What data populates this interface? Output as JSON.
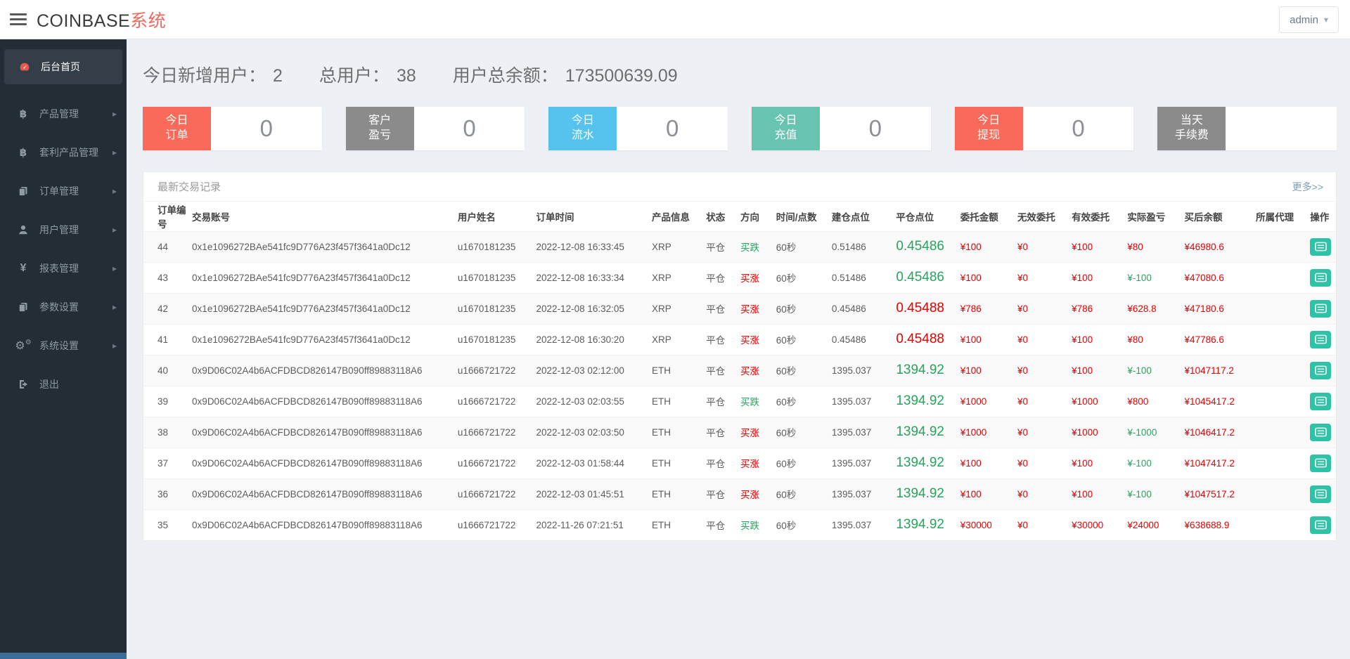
{
  "header": {
    "brand_main": "COINBASE",
    "brand_accent": "系统",
    "user_menu": "admin"
  },
  "colors": {
    "brand_accent_red": "#ed6a5e",
    "money_red": "#e60000",
    "gain_green": "#27a35d",
    "action_teal": "#2cc3a6",
    "sidebar_dark": "#232d36"
  },
  "sidebar": {
    "items": [
      {
        "label": "后台首页",
        "icon": "dashboard-icon",
        "active": true,
        "has_arrow": false
      },
      {
        "label": "产品管理",
        "icon": "bitcoin-icon",
        "active": false,
        "has_arrow": true
      },
      {
        "label": "套利产品管理",
        "icon": "bitcoin-icon",
        "active": false,
        "has_arrow": true
      },
      {
        "label": "订单管理",
        "icon": "copy-icon",
        "active": false,
        "has_arrow": true
      },
      {
        "label": "用户管理",
        "icon": "user-icon",
        "active": false,
        "has_arrow": true
      },
      {
        "label": "报表管理",
        "icon": "yen-icon",
        "active": false,
        "has_arrow": true
      },
      {
        "label": "参数设置",
        "icon": "copy-icon",
        "active": false,
        "has_arrow": true
      },
      {
        "label": "系统设置",
        "icon": "gears-icon",
        "active": false,
        "has_arrow": true
      },
      {
        "label": "退出",
        "icon": "signout-icon",
        "active": false,
        "has_arrow": false
      }
    ]
  },
  "stats": [
    {
      "label": "今日新增用户：",
      "value": "2"
    },
    {
      "label": "总用户：",
      "value": "38"
    },
    {
      "label": "用户总余额：",
      "value": "173500639.09"
    }
  ],
  "cards": [
    {
      "line1": "今日",
      "line2": "订单",
      "value": "0",
      "color": "#f96a5b"
    },
    {
      "line1": "客户",
      "line2": "盈亏",
      "value": "0",
      "color": "#8b8b8b"
    },
    {
      "line1": "今日",
      "line2": "流水",
      "value": "0",
      "color": "#55c3ee"
    },
    {
      "line1": "今日",
      "line2": "充值",
      "value": "0",
      "color": "#69c3b1"
    },
    {
      "line1": "今日",
      "line2": "提现",
      "value": "0",
      "color": "#f96a5b"
    },
    {
      "line1": "当天",
      "line2": "手续费",
      "value": "",
      "color": "#8b8b8b"
    }
  ],
  "panel": {
    "title": "最新交易记录",
    "more_link": "更多>>",
    "columns": [
      "订单编号",
      "交易账号",
      "用户姓名",
      "订单时间",
      "产品信息",
      "状态",
      "方向",
      "时间/点数",
      "建仓点位",
      "平仓点位",
      "委托金额",
      "无效委托",
      "有效委托",
      "实际盈亏",
      "买后余额",
      "所属代理",
      "操作"
    ],
    "rows": [
      {
        "id": "44",
        "account": "0x1e1096272BAe541fc9D776A23f457f3641a0Dc12",
        "username": "u1670181235",
        "time": "2022-12-08 16:33:45",
        "product": "XRP",
        "status": "平仓",
        "direction": "买跌",
        "direction_color": "green",
        "duration": "60秒",
        "open_point": "0.51486",
        "close_point": "0.45486",
        "close_color": "green",
        "amount": "¥100",
        "invalid": "¥0",
        "valid": "¥100",
        "profit": "¥80",
        "profit_color": "red",
        "balance": "¥46980.6",
        "agent": ""
      },
      {
        "id": "43",
        "account": "0x1e1096272BAe541fc9D776A23f457f3641a0Dc12",
        "username": "u1670181235",
        "time": "2022-12-08 16:33:34",
        "product": "XRP",
        "status": "平仓",
        "direction": "买涨",
        "direction_color": "red",
        "duration": "60秒",
        "open_point": "0.51486",
        "close_point": "0.45486",
        "close_color": "green",
        "amount": "¥100",
        "invalid": "¥0",
        "valid": "¥100",
        "profit": "¥-100",
        "profit_color": "green",
        "balance": "¥47080.6",
        "agent": ""
      },
      {
        "id": "42",
        "account": "0x1e1096272BAe541fc9D776A23f457f3641a0Dc12",
        "username": "u1670181235",
        "time": "2022-12-08 16:32:05",
        "product": "XRP",
        "status": "平仓",
        "direction": "买涨",
        "direction_color": "red",
        "duration": "60秒",
        "open_point": "0.45486",
        "close_point": "0.45488",
        "close_color": "red",
        "amount": "¥786",
        "invalid": "¥0",
        "valid": "¥786",
        "profit": "¥628.8",
        "profit_color": "red",
        "balance": "¥47180.6",
        "agent": ""
      },
      {
        "id": "41",
        "account": "0x1e1096272BAe541fc9D776A23f457f3641a0Dc12",
        "username": "u1670181235",
        "time": "2022-12-08 16:30:20",
        "product": "XRP",
        "status": "平仓",
        "direction": "买涨",
        "direction_color": "red",
        "duration": "60秒",
        "open_point": "0.45486",
        "close_point": "0.45488",
        "close_color": "red",
        "amount": "¥100",
        "invalid": "¥0",
        "valid": "¥100",
        "profit": "¥80",
        "profit_color": "red",
        "balance": "¥47786.6",
        "agent": ""
      },
      {
        "id": "40",
        "account": "0x9D06C02A4b6ACFDBCD826147B090ff89883118A6",
        "username": "u1666721722",
        "time": "2022-12-03 02:12:00",
        "product": "ETH",
        "status": "平仓",
        "direction": "买涨",
        "direction_color": "red",
        "duration": "60秒",
        "open_point": "1395.037",
        "close_point": "1394.92",
        "close_color": "green",
        "amount": "¥100",
        "invalid": "¥0",
        "valid": "¥100",
        "profit": "¥-100",
        "profit_color": "green",
        "balance": "¥1047117.2",
        "agent": ""
      },
      {
        "id": "39",
        "account": "0x9D06C02A4b6ACFDBCD826147B090ff89883118A6",
        "username": "u1666721722",
        "time": "2022-12-03 02:03:55",
        "product": "ETH",
        "status": "平仓",
        "direction": "买跌",
        "direction_color": "green",
        "duration": "60秒",
        "open_point": "1395.037",
        "close_point": "1394.92",
        "close_color": "green",
        "amount": "¥1000",
        "invalid": "¥0",
        "valid": "¥1000",
        "profit": "¥800",
        "profit_color": "red",
        "balance": "¥1045417.2",
        "agent": ""
      },
      {
        "id": "38",
        "account": "0x9D06C02A4b6ACFDBCD826147B090ff89883118A6",
        "username": "u1666721722",
        "time": "2022-12-03 02:03:50",
        "product": "ETH",
        "status": "平仓",
        "direction": "买涨",
        "direction_color": "red",
        "duration": "60秒",
        "open_point": "1395.037",
        "close_point": "1394.92",
        "close_color": "green",
        "amount": "¥1000",
        "invalid": "¥0",
        "valid": "¥1000",
        "profit": "¥-1000",
        "profit_color": "green",
        "balance": "¥1046417.2",
        "agent": ""
      },
      {
        "id": "37",
        "account": "0x9D06C02A4b6ACFDBCD826147B090ff89883118A6",
        "username": "u1666721722",
        "time": "2022-12-03 01:58:44",
        "product": "ETH",
        "status": "平仓",
        "direction": "买涨",
        "direction_color": "red",
        "duration": "60秒",
        "open_point": "1395.037",
        "close_point": "1394.92",
        "close_color": "green",
        "amount": "¥100",
        "invalid": "¥0",
        "valid": "¥100",
        "profit": "¥-100",
        "profit_color": "green",
        "balance": "¥1047417.2",
        "agent": ""
      },
      {
        "id": "36",
        "account": "0x9D06C02A4b6ACFDBCD826147B090ff89883118A6",
        "username": "u1666721722",
        "time": "2022-12-03 01:45:51",
        "product": "ETH",
        "status": "平仓",
        "direction": "买涨",
        "direction_color": "red",
        "duration": "60秒",
        "open_point": "1395.037",
        "close_point": "1394.92",
        "close_color": "green",
        "amount": "¥100",
        "invalid": "¥0",
        "valid": "¥100",
        "profit": "¥-100",
        "profit_color": "green",
        "balance": "¥1047517.2",
        "agent": ""
      },
      {
        "id": "35",
        "account": "0x9D06C02A4b6ACFDBCD826147B090ff89883118A6",
        "username": "u1666721722",
        "time": "2022-11-26 07:21:51",
        "product": "ETH",
        "status": "平仓",
        "direction": "买跌",
        "direction_color": "green",
        "duration": "60秒",
        "open_point": "1395.037",
        "close_point": "1394.92",
        "close_color": "green",
        "amount": "¥30000",
        "invalid": "¥0",
        "valid": "¥30000",
        "profit": "¥24000",
        "profit_color": "red",
        "balance": "¥638688.9",
        "agent": ""
      }
    ]
  }
}
